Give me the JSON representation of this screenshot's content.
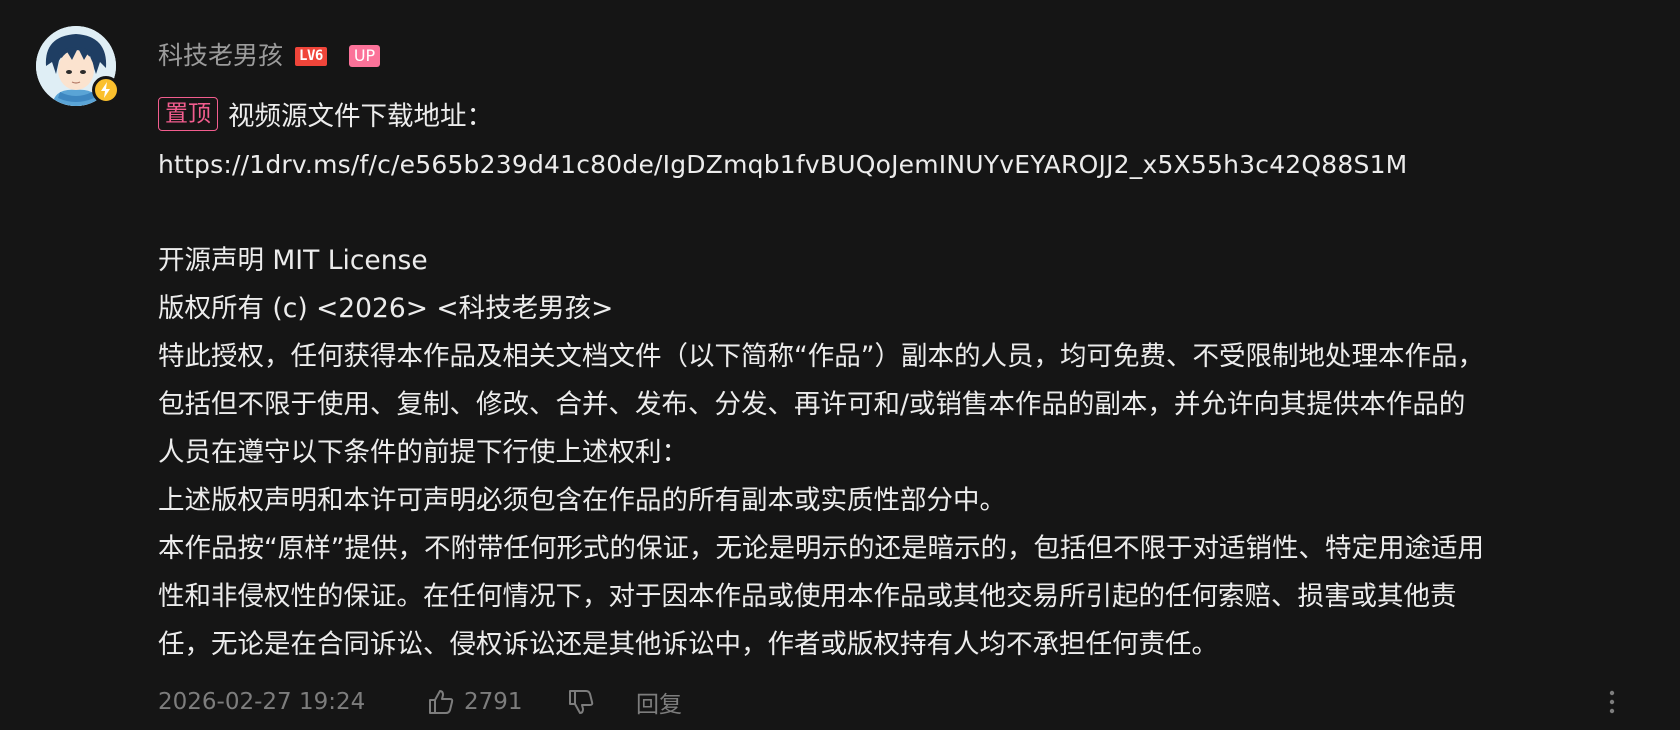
{
  "comment": {
    "author": {
      "name": "科技老男孩",
      "level_badge": "LV6",
      "up_badge": "UP"
    },
    "pin_tag": "置顶",
    "lines": [
      "视频源文件下载地址：",
      "https://1drv.ms/f/c/e565b239d41c80de/IgDZmqb1fvBUQoJemINUYvEYAROJJ2_x5X55h3c42Q88S1M",
      "",
      "开源声明 MIT License",
      "版权所有 (c) <2026> <科技老男孩>",
      "特此授权，任何获得本作品及相关文档文件（以下简称“作品”）副本的人员，均可免费、不受限制地处理本作品，",
      "包括但不限于使用、复制、修改、合并、发布、分发、再许可和/或销售本作品的副本，并允许向其提供本作品的",
      "人员在遵守以下条件的前提下行使上述权利：",
      "上述版权声明和本许可声明必须包含在作品的所有副本或实质性部分中。",
      "本作品按“原样”提供，不附带任何形式的保证，无论是明示的还是暗示的，包括但不限于对适销性、特定用途适用",
      "性和非侵权性的保证。在任何情况下，对于因本作品或使用本作品或其他交易所引起的任何索赔、损害或其他责",
      "任，无论是在合同诉讼、侵权诉讼还是其他诉讼中，作者或版权持有人均不承担任何责任。"
    ],
    "footer": {
      "timestamp": "2026-02-27 19:24",
      "like_count": "2791",
      "reply_label": "回复"
    },
    "icons": {
      "like": "thumbs-up-icon",
      "dislike": "thumbs-down-icon",
      "more": "more-vertical-icon",
      "badge": "lightning-icon"
    },
    "colors": {
      "background": "#151515",
      "pin": "#f25d8e",
      "up_badge": "#fb7299",
      "level_badge": "#f0453a",
      "avatar_badge": "#fbc02d"
    }
  }
}
